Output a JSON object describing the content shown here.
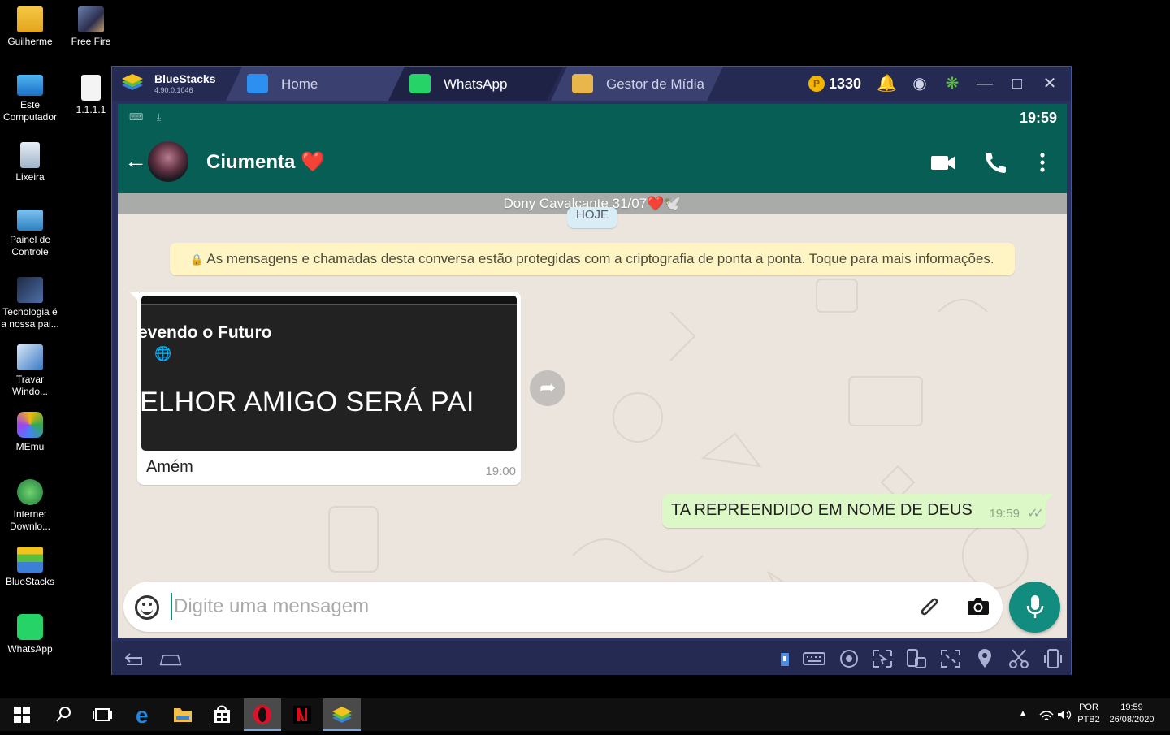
{
  "desktop": {
    "icons": [
      {
        "label": "Guilherme"
      },
      {
        "label": "Free Fire"
      },
      {
        "label": "Este Computador"
      },
      {
        "label": "1.1.1.1"
      },
      {
        "label": "Lixeira"
      },
      {
        "label": "Painel de Controle"
      },
      {
        "label": "Tecnologia é a nossa pai..."
      },
      {
        "label": "Travar Windo..."
      },
      {
        "label": "MEmu"
      },
      {
        "label": "Internet Downlo..."
      },
      {
        "label": "BlueStacks"
      },
      {
        "label": "WhatsApp"
      }
    ]
  },
  "bluestacks": {
    "name": "BlueStacks",
    "version": "4.90.0.1046",
    "tabs": [
      {
        "label": "Home",
        "icon": "home-icon"
      },
      {
        "label": "WhatsApp",
        "icon": "whatsapp-icon"
      },
      {
        "label": "Gestor de Mídia",
        "icon": "folder-icon"
      }
    ],
    "coins": "1330"
  },
  "android": {
    "time": "19:59"
  },
  "chat": {
    "contact_name": "Ciumenta",
    "contact_heart": "❤️",
    "banner": "Dony Cavalcante 31/07❤️🕊️",
    "date_chip": "HOJE",
    "encryption_notice": "As mensagens e chamadas desta conversa estão protegidas com a criptografia de ponta a ponta. Toque para mais informações.",
    "incoming": {
      "preview_title": "evendo o Futuro",
      "preview_headline": "ELHOR AMIGO SERÁ PAI",
      "text": "Amém",
      "time": "19:00"
    },
    "outgoing": {
      "text": "TA REPREENDIDO EM NOME DE DEUS",
      "time": "19:59",
      "status": "read"
    },
    "input_placeholder": "Digite uma mensagem"
  },
  "taskbar": {
    "language": "POR",
    "layout": "PTB2",
    "time": "19:59",
    "date": "26/08/2020"
  },
  "colors": {
    "wa_green": "#075e54",
    "wa_teal": "#128c7e",
    "bubble_out": "#dcf8c6",
    "bs_dark": "#252a52"
  }
}
